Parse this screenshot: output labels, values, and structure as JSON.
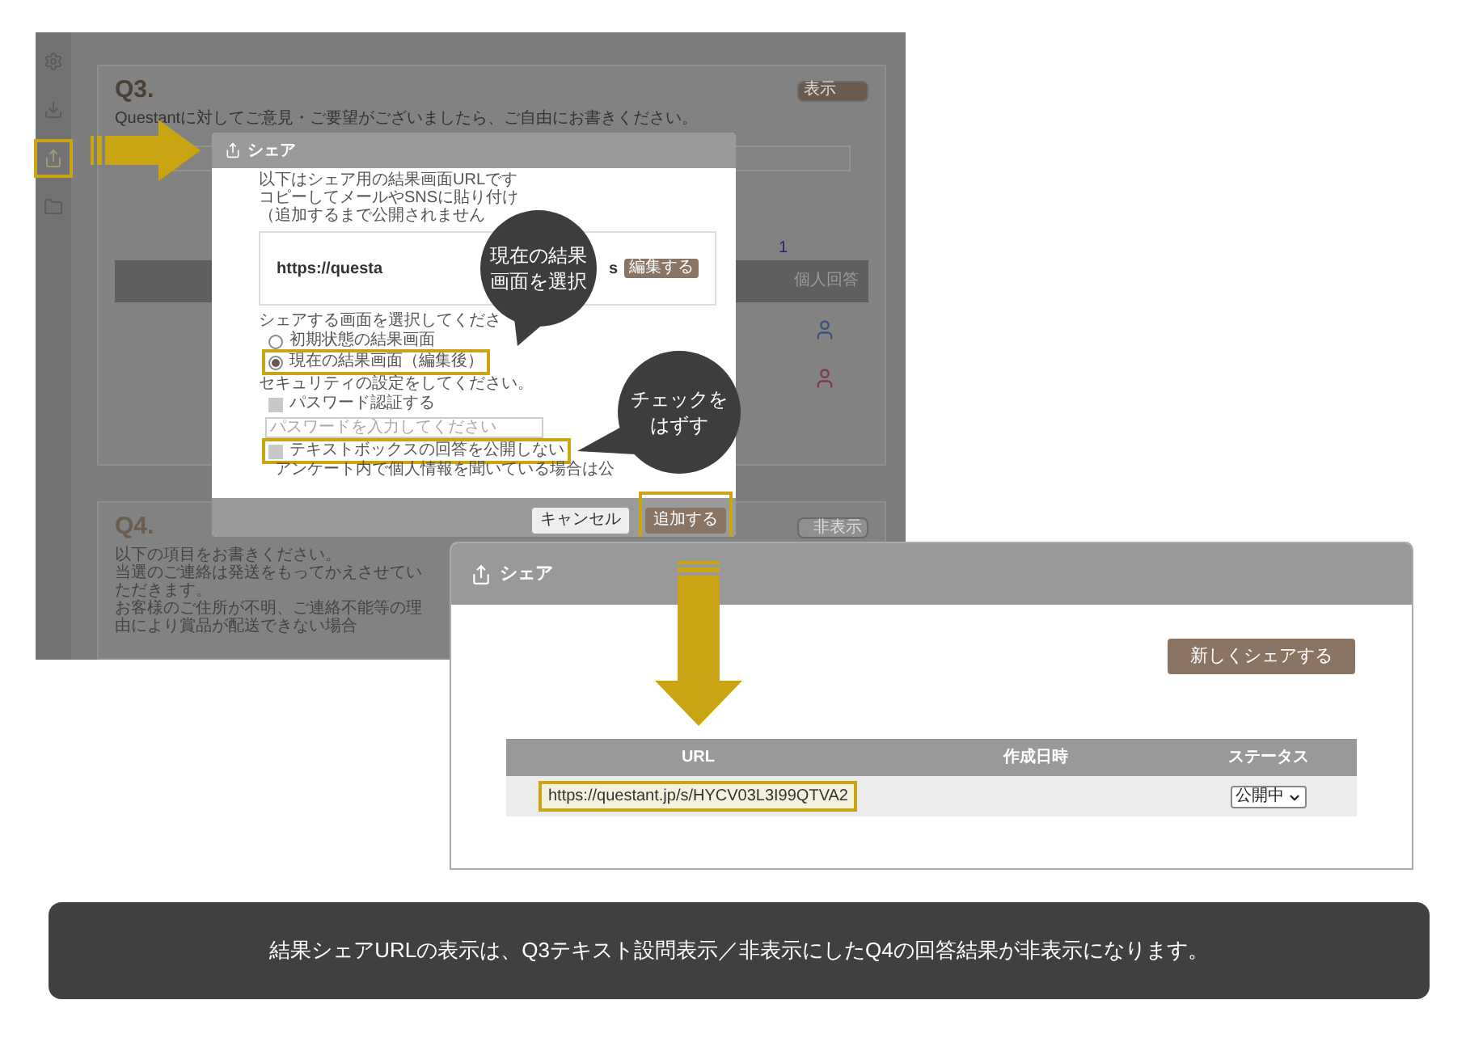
{
  "background_screen": {
    "sidebar": {
      "items": [
        {
          "kind": "settings",
          "highlighted": false
        },
        {
          "kind": "download",
          "highlighted": false
        },
        {
          "kind": "share",
          "highlighted": true
        },
        {
          "kind": "folder",
          "highlighted": false
        }
      ]
    },
    "q3": {
      "number": "Q3.",
      "prompt": "Questantに対してご意見・ご要望がございましたら、ご自由にお書きください。",
      "toggle": "表示",
      "toggle_on": true,
      "count": "1",
      "header": "個人回答"
    },
    "q4": {
      "number": "Q4.",
      "lines": [
        "以下の項目をお書きください。",
        "当選のご連絡は発送をもってかえさせていただきます。",
        "お客様のご住所が不明、ご連絡不能等の理由により賞品が配送できない場合"
      ],
      "toggle": "非表示",
      "toggle_on": false
    }
  },
  "share_dialog": {
    "title": "シェア",
    "intro": [
      "以下はシェア用の結果画面URLです",
      "コピーしてメールやSNSに貼り付け",
      "（追加するまで公開されません"
    ],
    "url_start": "https://questa",
    "url_end": "s",
    "edit_button": "編集する",
    "screen_prompt": "シェアする画面を選択してくださ",
    "screens": [
      {
        "label": "初期状態の結果画面",
        "selected": false,
        "highlighted": false
      },
      {
        "label": "現在の結果画面（編集後）",
        "selected": true,
        "highlighted": true
      }
    ],
    "security_prompt": "セキュリティの設定をしてください。",
    "options": [
      {
        "kind": "checkbox",
        "label": "パスワード認証する",
        "checked": false,
        "highlighted": false
      },
      {
        "kind": "input",
        "placeholder": "パスワードを入力してください"
      },
      {
        "kind": "checkbox",
        "label": "テキストボックスの回答を公開しない",
        "checked": false,
        "highlighted": true
      }
    ],
    "note": "アンケート内で個人情報を聞いている場合は公",
    "buttons": [
      {
        "label": "キャンセル",
        "kind": "secondary",
        "highlighted": false
      },
      {
        "label": "追加する",
        "kind": "primary",
        "highlighted": true
      }
    ]
  },
  "callouts": [
    {
      "lines": [
        "現在の結果",
        "画面を選択"
      ]
    },
    {
      "lines": [
        "チェックを",
        "はずす"
      ]
    }
  ],
  "share_list": {
    "title": "シェア",
    "new_button": "新しくシェアする",
    "columns": [
      "URL",
      "作成日時",
      "ステータス"
    ],
    "rows": [
      {
        "url": "https://questant.jp/s/HYCV03L3I99QTVA2",
        "url_highlighted": true,
        "status": "公開中"
      }
    ]
  },
  "caption": "結果シェアURLの表示は、Q3テキスト設問表示／非表示にしたQ4の回答結果が非表示になります。"
}
